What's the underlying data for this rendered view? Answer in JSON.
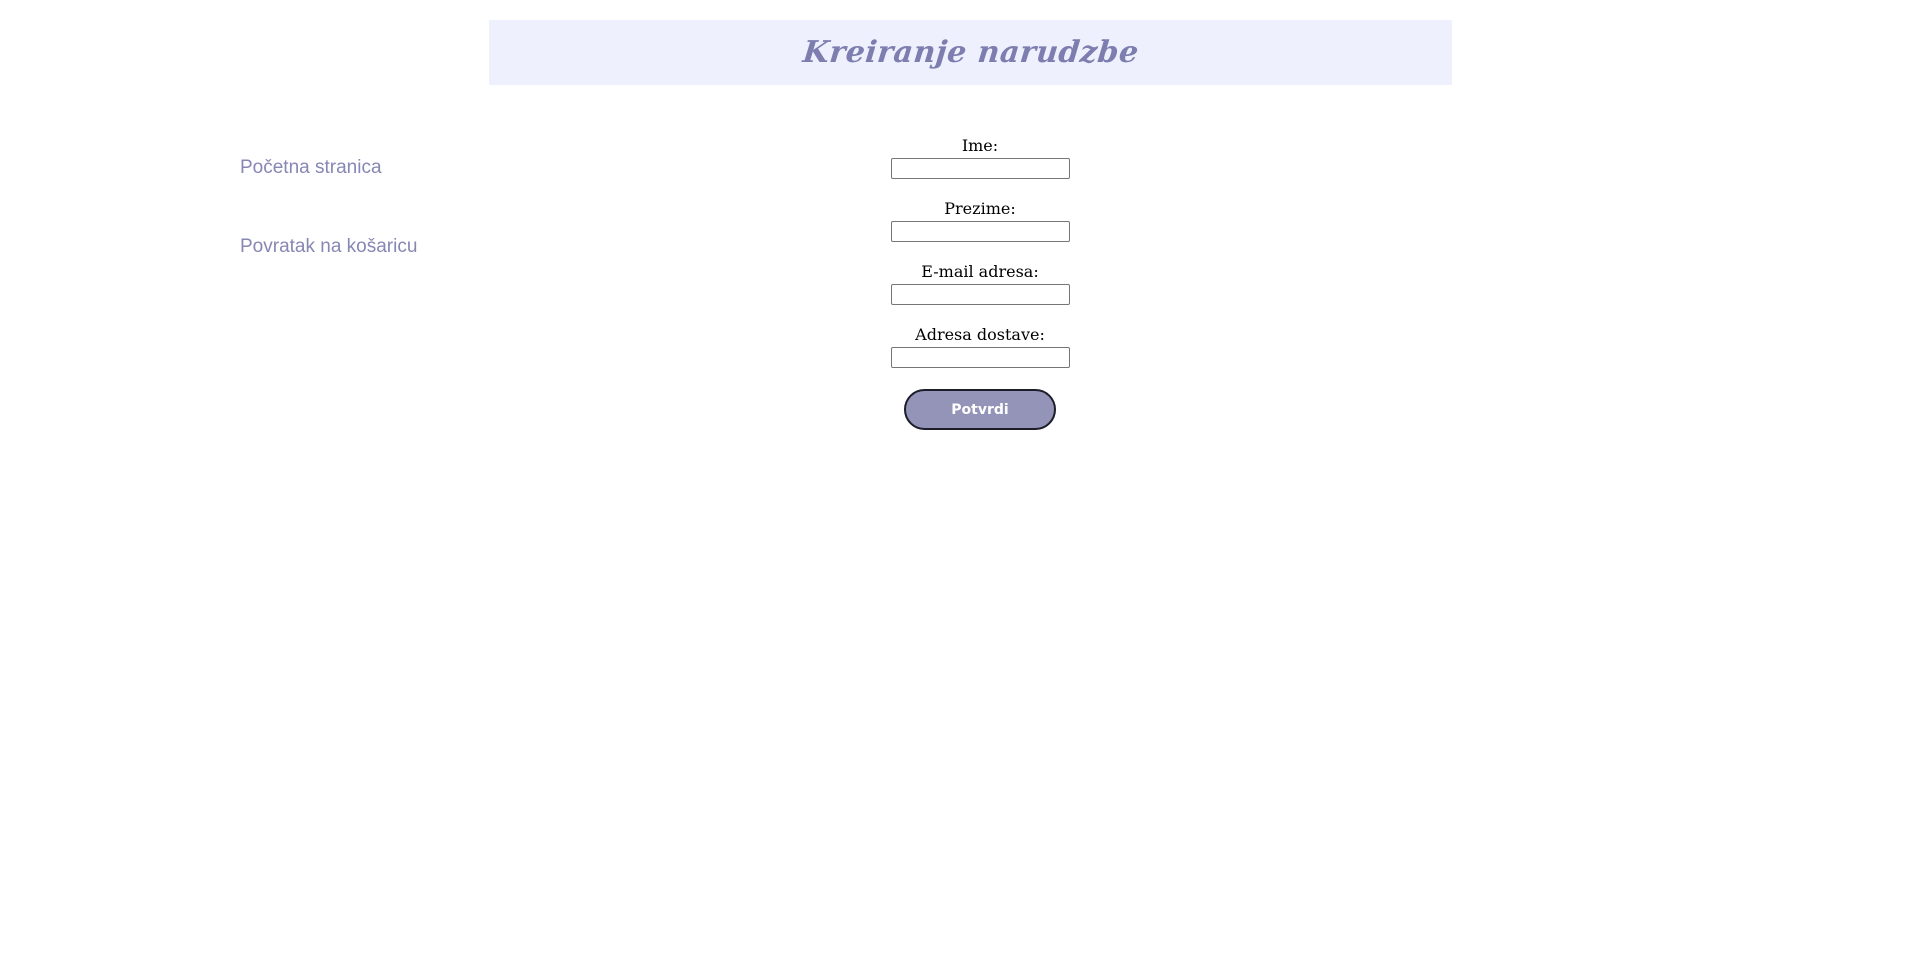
{
  "header": {
    "title": "Kreiranje narudzbe"
  },
  "nav": {
    "home_label": "Početna stranica",
    "cart_label": "Povratak na košaricu"
  },
  "form": {
    "fields": [
      {
        "label": "Ime:",
        "value": "",
        "placeholder": ""
      },
      {
        "label": "Prezime:",
        "value": "",
        "placeholder": ""
      },
      {
        "label": "E-mail adresa:",
        "value": "",
        "placeholder": ""
      },
      {
        "label": "Adresa dostave:",
        "value": "",
        "placeholder": ""
      }
    ],
    "submit_label": "Potvrdi"
  },
  "colors": {
    "header_background": "#eef1fd",
    "title_color": "#7d7eaf",
    "link_color": "#8687b3",
    "button_background": "#9394b8"
  }
}
